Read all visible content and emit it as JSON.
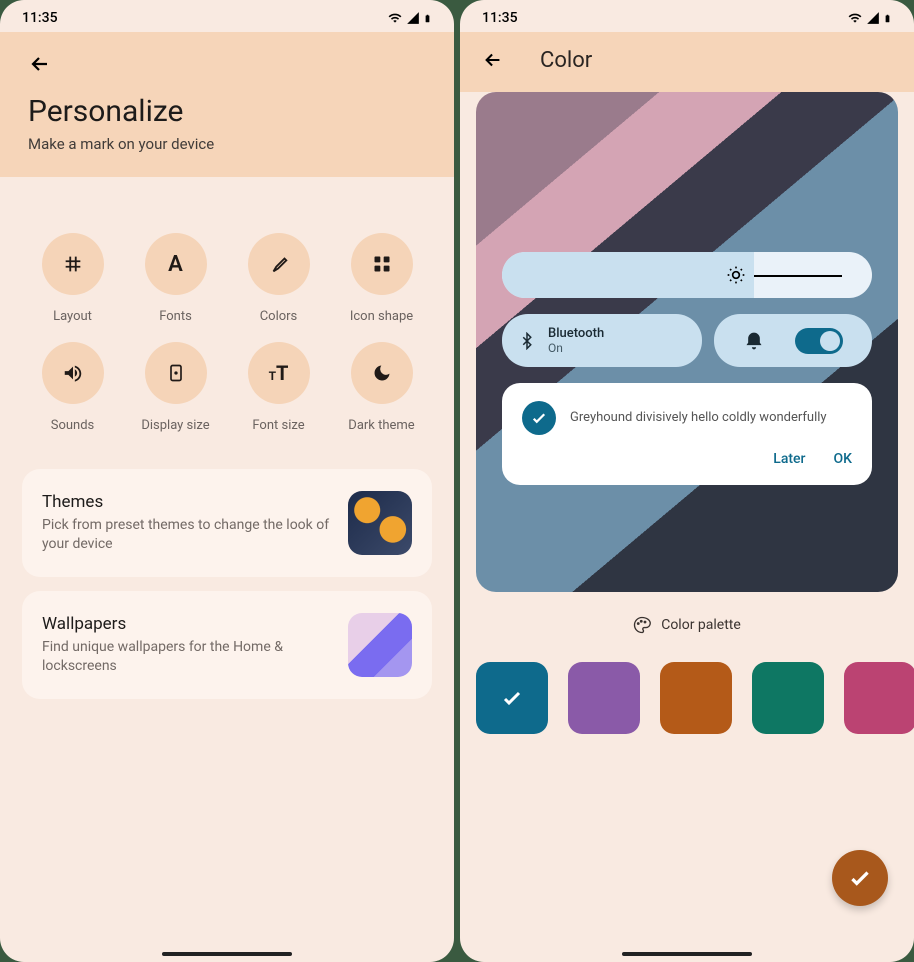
{
  "status": {
    "time": "11:35"
  },
  "left": {
    "title": "Personalize",
    "subtitle": "Make a mark on your device",
    "grid": {
      "layout": "Layout",
      "fonts": "Fonts",
      "colors": "Colors",
      "icon_shape": "Icon shape",
      "sounds": "Sounds",
      "display_size": "Display size",
      "font_size": "Font size",
      "dark_theme": "Dark theme"
    },
    "themes": {
      "title": "Themes",
      "desc": "Pick from preset themes to change the look of your device"
    },
    "wallpapers": {
      "title": "Wallpapers",
      "desc": "Find unique wallpapers for the Home & lockscreens"
    }
  },
  "right": {
    "title": "Color",
    "bluetooth": {
      "title": "Bluetooth",
      "state": "On"
    },
    "notification": {
      "text": "Greyhound divisively hello coldly wonderfully",
      "later": "Later",
      "ok": "OK"
    },
    "palette_label": "Color palette",
    "swatches": [
      "#0e6a8c",
      "#8a5aa8",
      "#b45a18",
      "#0e7763",
      "#bb4372"
    ],
    "selected_swatch": 0
  }
}
